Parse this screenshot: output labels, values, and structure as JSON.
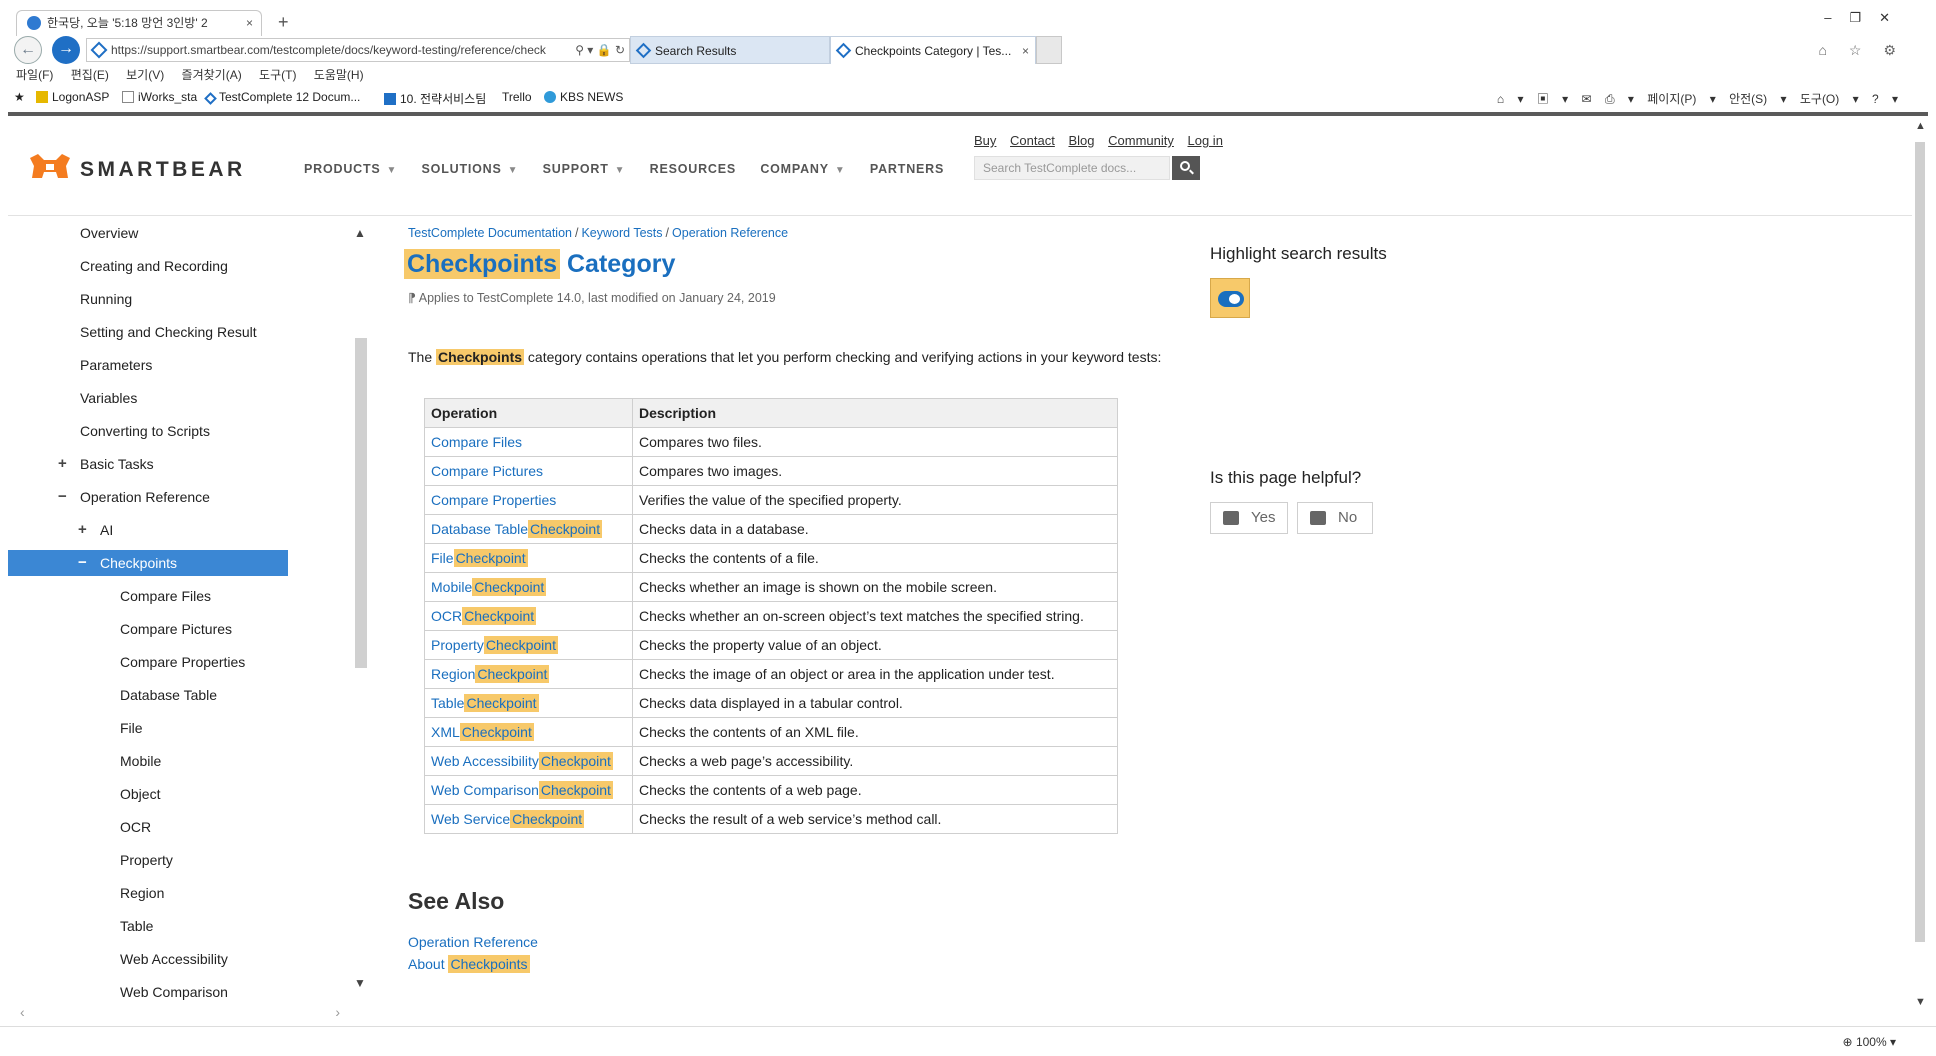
{
  "browser": {
    "top_tab_title": "한국당, 오늘 '5:18 망언 3인방' 2",
    "url": "https://support.smartbear.com/testcomplete/docs/keyword-testing/reference/check",
    "url_tools": "⚲ ▾ 🔒 ↻",
    "tabs": [
      {
        "label": "Search Results"
      },
      {
        "label": "Checkpoints Category | Tes..."
      }
    ],
    "menu": "파일(F) 편집(E) 보기(V) 즐겨찾기(A) 도구(T) 도움말(H)",
    "favorites": [
      "LogonASP",
      "iWorks_sta",
      "TestComplete 12 Docum...",
      "10. 전략서비스팀",
      "Trello",
      "KBS NEWS"
    ],
    "command_bar": [
      "페이지(P) ▾",
      "안전(S) ▾",
      "도구(O) ▾"
    ],
    "zoom": "100%"
  },
  "header": {
    "logo_text": "SMARTBEAR",
    "nav": [
      "PRODUCTS",
      "SOLUTIONS",
      "SUPPORT",
      "RESOURCES",
      "COMPANY",
      "PARTNERS"
    ],
    "nav_has_chevron": [
      true,
      true,
      true,
      false,
      true,
      false
    ],
    "top_links": [
      "Buy",
      "Contact",
      "Blog",
      "Community",
      "Log in"
    ],
    "search_placeholder": "Search TestComplete docs..."
  },
  "sidebar": {
    "items": [
      {
        "label": "Overview",
        "level": 1
      },
      {
        "label": "Creating and Recording",
        "level": 1
      },
      {
        "label": "Running",
        "level": 1
      },
      {
        "label": "Setting and Checking Result",
        "level": 1
      },
      {
        "label": "Parameters",
        "level": 1
      },
      {
        "label": "Variables",
        "level": 1
      },
      {
        "label": "Converting to Scripts",
        "level": 1
      },
      {
        "label": "Basic Tasks",
        "level": 1,
        "expander": "+"
      },
      {
        "label": "Operation Reference",
        "level": 1,
        "expander": "−"
      },
      {
        "label": "AI",
        "level": 2,
        "expander": "+"
      },
      {
        "label": "Checkpoints",
        "level": 2,
        "expander": "−",
        "active": true
      },
      {
        "label": "Compare Files",
        "level": 3
      },
      {
        "label": "Compare Pictures",
        "level": 3
      },
      {
        "label": "Compare Properties",
        "level": 3
      },
      {
        "label": "Database Table",
        "level": 3
      },
      {
        "label": "File",
        "level": 3
      },
      {
        "label": "Mobile",
        "level": 3
      },
      {
        "label": "Object",
        "level": 3
      },
      {
        "label": "OCR",
        "level": 3
      },
      {
        "label": "Property",
        "level": 3
      },
      {
        "label": "Region",
        "level": 3
      },
      {
        "label": "Table",
        "level": 3
      },
      {
        "label": "Web Accessibility",
        "level": 3
      },
      {
        "label": "Web Comparison",
        "level": 3
      }
    ]
  },
  "main": {
    "breadcrumb": [
      "TestComplete Documentation",
      "Keyword Tests",
      "Operation Reference"
    ],
    "title_highlight": "Checkpoints",
    "title_rest": "Category",
    "applies": "Applies to TestComplete 14.0, last modified on January 24, 2019",
    "intro_pre": "The",
    "intro_highlight": "Checkpoints",
    "intro_post": "category contains operations that let you perform checking and verifying actions in your keyword tests:",
    "table_headers": [
      "Operation",
      "Description"
    ],
    "rows": [
      {
        "op": "Compare Files",
        "hl": "",
        "desc": "Compares two files."
      },
      {
        "op": "Compare Pictures",
        "hl": "",
        "desc": "Compares two images."
      },
      {
        "op": "Compare Properties",
        "hl": "",
        "desc": "Verifies the value of the specified property."
      },
      {
        "op": "Database Table",
        "hl": "Checkpoint",
        "desc": "Checks data in a database."
      },
      {
        "op": "File",
        "hl": "Checkpoint",
        "desc": "Checks the contents of a file."
      },
      {
        "op": "Mobile",
        "hl": "Checkpoint",
        "desc": "Checks whether an image is shown on the mobile screen."
      },
      {
        "op": "OCR",
        "hl": "Checkpoint",
        "desc": "Checks whether an on-screen object’s text matches the specified string."
      },
      {
        "op": "Property",
        "hl": "Checkpoint",
        "desc": "Checks the property value of an object."
      },
      {
        "op": "Region",
        "hl": "Checkpoint",
        "desc": "Checks the image of an object or area in the application under test."
      },
      {
        "op": "Table",
        "hl": "Checkpoint",
        "desc": "Checks data displayed in a tabular control."
      },
      {
        "op": "XML",
        "hl": "Checkpoint",
        "desc": "Checks the contents of an XML file."
      },
      {
        "op": "Web Accessibility",
        "hl": "Checkpoint",
        "desc": "Checks a web page’s accessibility."
      },
      {
        "op": "Web Comparison",
        "hl": "Checkpoint",
        "desc": "Checks the contents of a web page."
      },
      {
        "op": "Web Service",
        "hl": "Checkpoint",
        "desc": "Checks the result of a web service’s method call."
      }
    ],
    "see_also_heading": "See Also",
    "see_also": [
      {
        "text": "Operation Reference",
        "hl": ""
      },
      {
        "text": "About",
        "hl": "Checkpoints"
      }
    ]
  },
  "right_panel": {
    "highlight_label": "Highlight search results",
    "highlight_on": true,
    "helpful_label": "Is this page helpful?",
    "yes": "Yes",
    "no": "No"
  },
  "colors": {
    "accent": "#1a6fbf",
    "highlight": "#f7c96a",
    "active_nav": "#3b87d4",
    "brand_orange": "#f47c20"
  }
}
